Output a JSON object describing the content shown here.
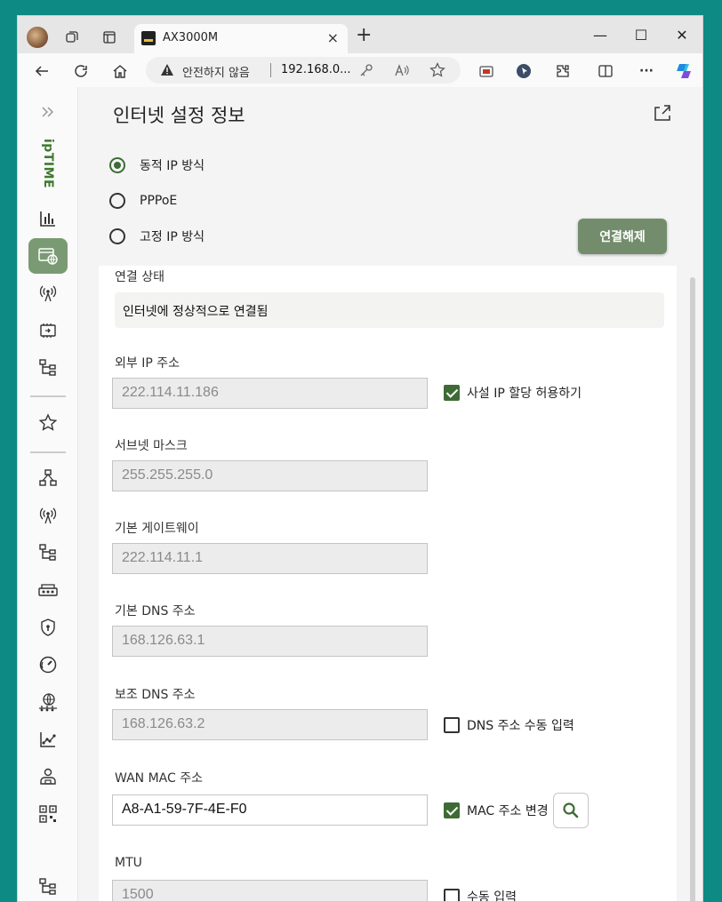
{
  "browser": {
    "tab_title": "AX3000M",
    "tab_close": "×",
    "new_tab": "+",
    "minimize": "—",
    "maximize": "☐",
    "close": "✕",
    "security_warning": "안전하지 않음",
    "url": "192.168.0...",
    "more": "···"
  },
  "page": {
    "title": "인터넷 설정 정보",
    "logo_text": "ipTIME"
  },
  "connection_modes": [
    {
      "label": "동적 IP 방식",
      "selected": true
    },
    {
      "label": "PPPoE",
      "selected": false
    },
    {
      "label": "고정 IP 방식",
      "selected": false
    }
  ],
  "disconnect_button": "연결해제",
  "fields": {
    "status_label": "연결 상태",
    "status_value": "인터넷에 정상적으로 연결됨",
    "external_ip_label": "외부 IP 주소",
    "external_ip_value": "222.114.11.186",
    "private_ip_checkbox": "사설 IP 할당 허용하기",
    "subnet_label": "서브넷 마스크",
    "subnet_value": "255.255.255.0",
    "gateway_label": "기본 게이트웨이",
    "gateway_value": "222.114.11.1",
    "dns1_label": "기본 DNS 주소",
    "dns1_value": "168.126.63.1",
    "dns2_label": "보조 DNS 주소",
    "dns2_value": "168.126.63.2",
    "dns_manual_checkbox": "DNS 주소 수동 입력",
    "mac_label": "WAN MAC 주소",
    "mac_value": "A8-A1-59-7F-4E-F0",
    "mac_change_checkbox": "MAC 주소 변경",
    "mtu_label": "MTU",
    "mtu_value": "1500",
    "mtu_manual_checkbox": "수동 입력"
  },
  "checkbox_states": {
    "private_ip": true,
    "dns_manual": false,
    "mac_change": true,
    "mtu_manual": false
  },
  "colors": {
    "accent_green": "#3e6b35",
    "button_green": "#738d6c",
    "desktop_teal": "#0d8a84"
  }
}
